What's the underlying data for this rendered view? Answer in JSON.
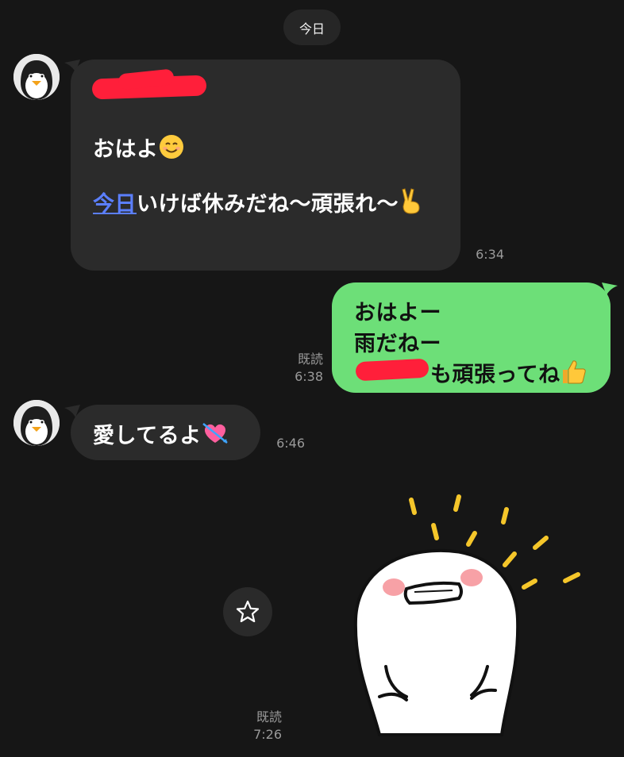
{
  "date_label": "今日",
  "messages": [
    {
      "line1": "おはよ",
      "line2_link": "今日",
      "line2_rest": "いけば休みだね〜頑張れ〜",
      "time": "6:34"
    },
    {
      "line1": "おはよー",
      "line2": "雨だねー",
      "line3": "も頑張ってね",
      "read": "既読",
      "time": "6:38"
    },
    {
      "text": "愛してるよ",
      "time": "6:46"
    },
    {
      "read": "既読",
      "time": "7:26"
    }
  ],
  "icons": {
    "avatar": "penguin-avatar-icon",
    "star": "star-icon",
    "smile": "smiling-face-emoji",
    "victory": "victory-hand-emoji",
    "thumbs": "thumbs-up-emoji",
    "heart": "heart-with-arrow-emoji"
  },
  "colors": {
    "background": "#161616",
    "incoming_bubble": "#2b2b2b",
    "outgoing_bubble": "#6ddf78",
    "link": "#5b7fff",
    "redaction": "#ff1f3a"
  }
}
